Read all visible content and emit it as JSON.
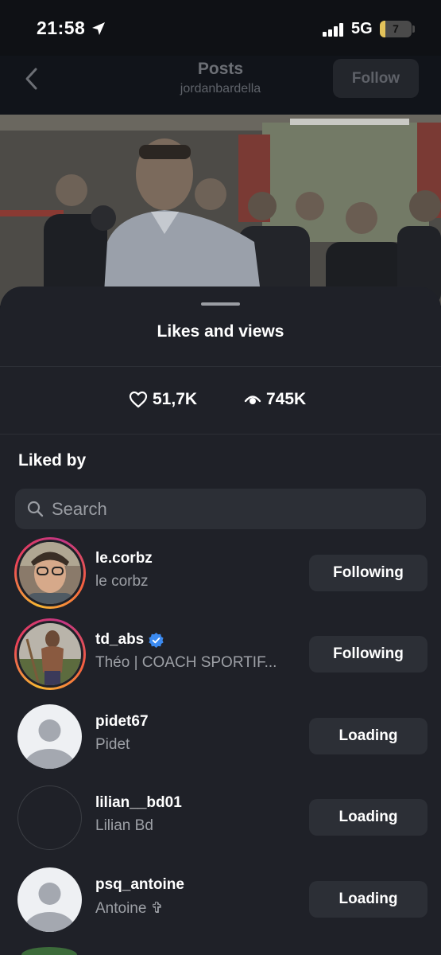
{
  "status_bar": {
    "time": "21:58",
    "network": "5G",
    "battery": "7",
    "battery_fraction": 0.07
  },
  "nav": {
    "title": "Posts",
    "subtitle": "jordanbardella",
    "follow_label": "Follow"
  },
  "sheet": {
    "title": "Likes and views",
    "likes": "51,7K",
    "views": "745K",
    "liked_by_label": "Liked by",
    "search_placeholder": "Search"
  },
  "users": [
    {
      "username": "le.corbz",
      "fullname": "le corbz",
      "button": "Following",
      "verified": false
    },
    {
      "username": "td_abs",
      "fullname": "Théo | COACH SPORTIF...",
      "button": "Following",
      "verified": true
    },
    {
      "username": "pidet67",
      "fullname": "Pidet",
      "button": "Loading",
      "verified": false
    },
    {
      "username": "lilian__bd01",
      "fullname": "Lilian Bd",
      "button": "Loading",
      "verified": false
    },
    {
      "username": "psq_antoine",
      "fullname": "Antoine ✞",
      "button": "Loading",
      "verified": false
    }
  ],
  "colors": {
    "background": "#1f2128",
    "button": "#2c2f36",
    "verified": "#3b8af0"
  }
}
